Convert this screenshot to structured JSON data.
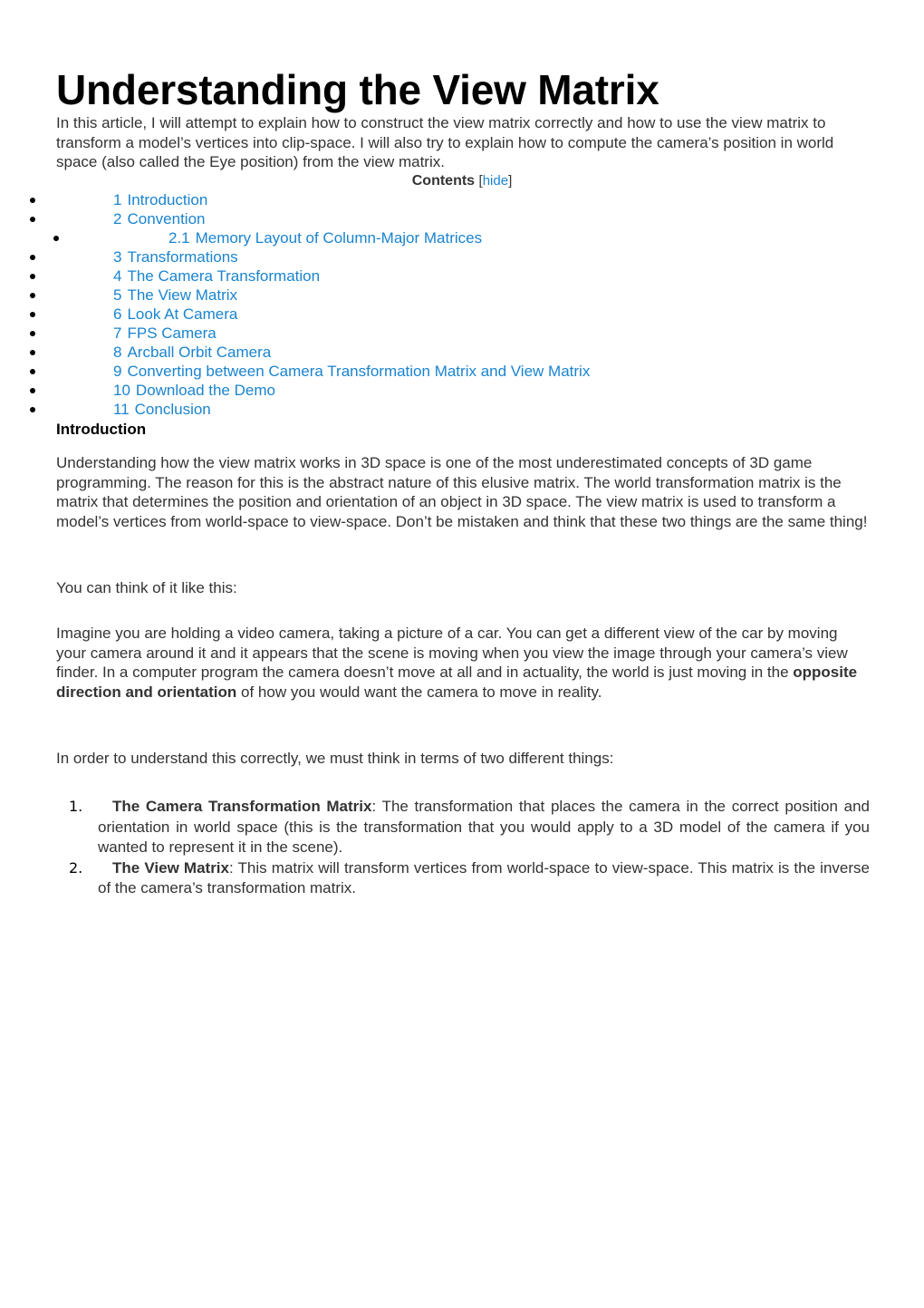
{
  "title": "Understanding the View Matrix",
  "intro": "In this article, I will attempt to explain how to construct the view matrix correctly and how to use the view matrix to transform a model’s vertices into clip-space.  I will also try to explain how to compute the camera’s position in world space (also called the Eye position) from the view matrix.",
  "toc": {
    "title": "Contents",
    "toggle_open": "[",
    "toggle_label": "hide",
    "toggle_close": "]",
    "items": [
      {
        "num": "1",
        "label": "Introduction",
        "level": 1
      },
      {
        "num": "2",
        "label": "Convention",
        "level": 1
      },
      {
        "num": "2.1",
        "label": "Memory Layout of Column-Major Matrices",
        "level": 2
      },
      {
        "num": "3",
        "label": "Transformations",
        "level": 1
      },
      {
        "num": "4",
        "label": "The Camera Transformation",
        "level": 1
      },
      {
        "num": "5",
        "label": "The View Matrix",
        "level": 1
      },
      {
        "num": "6",
        "label": "Look At Camera",
        "level": 1
      },
      {
        "num": "7",
        "label": "FPS Camera",
        "level": 1
      },
      {
        "num": "8",
        "label": "Arcball Orbit Camera",
        "level": 1
      },
      {
        "num": "9",
        "label": "Converting between Camera Transformation Matrix and View Matrix",
        "level": 1
      },
      {
        "num": "10",
        "label": "Download the Demo",
        "level": 1
      },
      {
        "num": "11",
        "label": "Conclusion",
        "level": 1
      }
    ]
  },
  "section": {
    "heading": "Introduction",
    "p1": "Understanding how the view matrix works in 3D space is one of the most underestimated concepts of 3D game programming.  The reason for this is the abstract nature of this elusive matrix.  The world transformation matrix is the matrix that determines the position and orientation of an object in 3D space.  The view matrix is used to transform a model’s vertices from world-space to view-space.  Don’t be mistaken and think that these two things are the same thing!",
    "p2": "You can think of it like this:",
    "p3_before": "Imagine you are holding a video camera, taking a picture of a car. You can get a different view of the car by moving your camera around it and it appears that the scene is moving when you view the image through your camera’s view finder.  In a computer program the camera doesn’t move at all and in actuality, the world is just moving in the ",
    "p3_bold": "opposite direction and orientation",
    "p3_after": " of how you would want the camera to move in reality.",
    "p4": "In order to understand this correctly, we must think in terms of two different things:",
    "definitions": [
      {
        "marker": "1.",
        "term": "The Camera Transformation Matrix",
        "text": ": The transformation that places the camera in the correct position and orientation in world space (this is the transformation that you would apply to a 3D model of the camera if you wanted to represent it in the scene)."
      },
      {
        "marker": "2.",
        "term": "The View Matrix",
        "text": ": This matrix will transform vertices from world-space to view-space.  This matrix is the inverse of the camera’s transformation matrix."
      }
    ]
  },
  "colors": {
    "link": "#1a84d0",
    "text": "#333333",
    "heading": "#000000"
  }
}
